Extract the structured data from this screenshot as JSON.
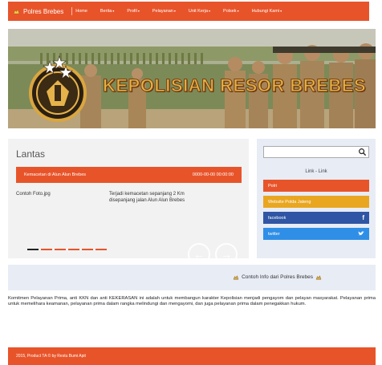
{
  "nav": {
    "brand": "Polres Brebes",
    "items": [
      {
        "label": "Home",
        "dropdown": false
      },
      {
        "label": "Berita",
        "dropdown": true
      },
      {
        "label": "Profil",
        "dropdown": true
      },
      {
        "label": "Pelayanan",
        "dropdown": true
      },
      {
        "label": "Unit Kerja",
        "dropdown": true
      },
      {
        "label": "Polsek",
        "dropdown": true
      },
      {
        "label": "Hubungi Kami",
        "dropdown": true
      }
    ]
  },
  "banner": {
    "title": "KEPOLISIAN RESOR BREBES"
  },
  "news": {
    "title": "Lantas",
    "slide_title": "Kemacetan di Alun Alun Brebes",
    "slide_date": "0000-00-00 00:00:00",
    "photo_label": "Contoh Foto.jpg",
    "description": "Terjadi kemacetan sepanjang 2 Km disepanjang jalan Alun Alun Brebes",
    "slide_count": 6,
    "active_slide": 1
  },
  "sidebar": {
    "search_value": "",
    "links_title": "Link - Link",
    "links": [
      {
        "label": "Polri",
        "color": "#e8542a",
        "icon": ""
      },
      {
        "label": "Website Polda Jateng",
        "color": "#e9a620",
        "icon": ""
      },
      {
        "label": "facebook",
        "color": "#2f55a4",
        "icon": "f"
      },
      {
        "label": "twitter",
        "color": "#2f8fe6",
        "icon": "twitter-bird"
      }
    ]
  },
  "info": {
    "text": "Contoh Info dari Polres Brebes"
  },
  "paragraph": "Komitmen Pelayanan Prima, anti KKN dan anti KEKERASAN ini adalah untuk membangun karakter Kepolisian menjadi pengayom dan pelayan masyarakat. Pelayanan prima untuk memelihara keamanan, pelayanan prima dalam rangka melindungi dan mengayomi, dan juga pelayanan prima dalam penegakkan hukum.",
  "footer": {
    "text": "2015, Product TA © by Restu Bumi Apit"
  },
  "colors": {
    "accent": "#e8542a",
    "panel": "#f2f2f2",
    "sidebar": "#e8ecf5"
  }
}
